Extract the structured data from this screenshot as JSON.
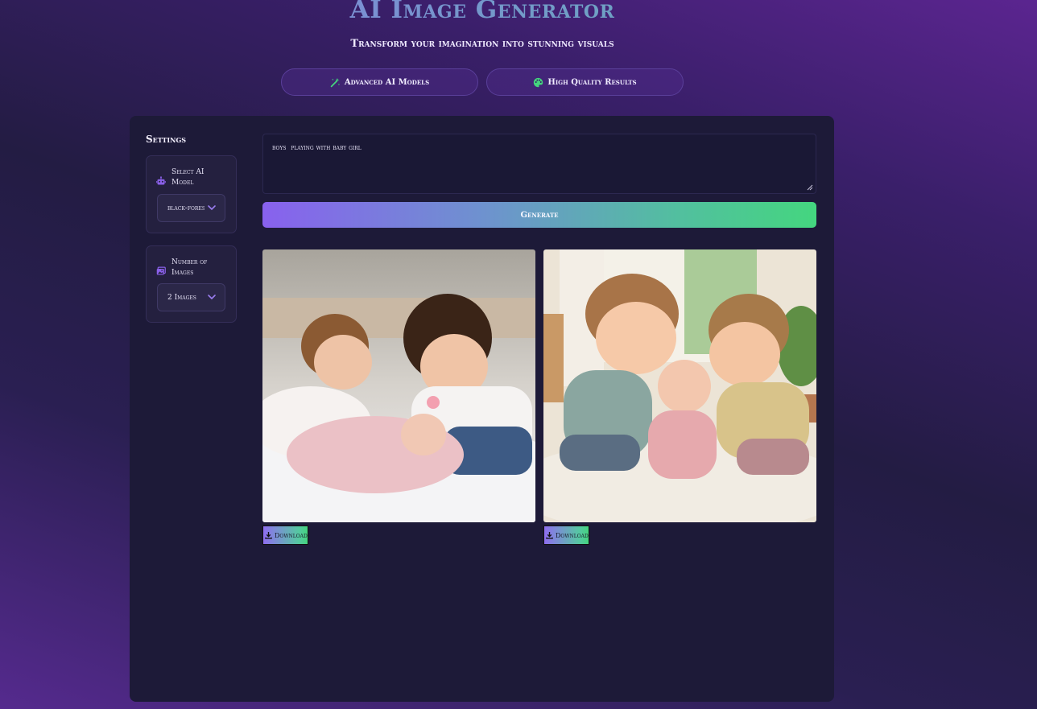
{
  "header": {
    "title": "AI Image Generator",
    "subtitle": "Transform your imagination into stunning visuals"
  },
  "features": [
    {
      "label": "Advanced AI Models",
      "icon": "magic-wand-icon"
    },
    {
      "label": "High Quality Results",
      "icon": "palette-icon"
    }
  ],
  "settings": {
    "title": "Settings",
    "model": {
      "label": "Select AI Model",
      "icon": "robot-icon",
      "value": "black-forest-labs/FLUX"
    },
    "count": {
      "label": "Number of Images",
      "icon": "images-icon",
      "value": "2 Images"
    }
  },
  "prompt": {
    "value": "boys  playing with baby girl"
  },
  "generate": {
    "label": "Generate"
  },
  "results": [
    {
      "alt": "boys playing with baby girl — photo",
      "download_label": "Download"
    },
    {
      "alt": "boys playing with baby girl — illustration",
      "download_label": "Download"
    }
  ],
  "colors": {
    "accent_purple": "#8861ee",
    "accent_green": "#44d67f",
    "panel_bg": "#1d1a38"
  }
}
